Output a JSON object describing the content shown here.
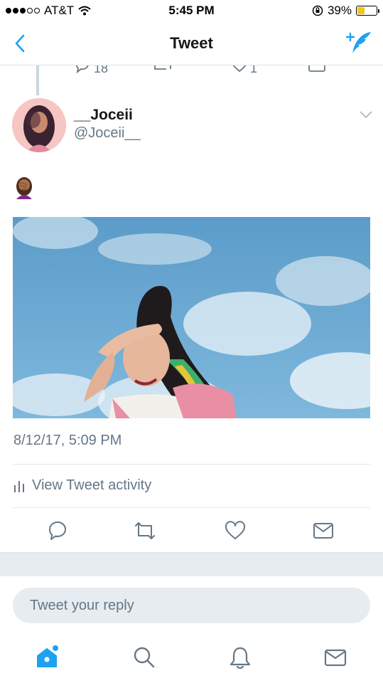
{
  "status_bar": {
    "carrier": "AT&T",
    "time": "5:45 PM",
    "battery_percent": "39%",
    "battery_level": 0.39,
    "signal_bars_filled": 3,
    "signal_bars_total": 5
  },
  "nav": {
    "title": "Tweet"
  },
  "previous_tweet": {
    "reply_count": "18",
    "like_count": "1"
  },
  "tweet": {
    "author_name": "__Joceii",
    "author_handle": "@Joceii__",
    "text_emoji": "🤦🏾‍♀️",
    "timestamp": "8/12/17, 5:09 PM",
    "activity_label": "View Tweet activity"
  },
  "reply": {
    "placeholder": "Tweet your reply"
  },
  "colors": {
    "accent": "#1da1f2",
    "muted": "#657786",
    "divider": "#e1e8ed"
  },
  "icons": {
    "back": "chevron-left-icon",
    "compose": "compose-quill-icon",
    "reply": "reply-bubble-icon",
    "retweet": "retweet-icon",
    "like": "heart-icon",
    "dm": "envelope-icon",
    "home": "home-icon",
    "search": "search-icon",
    "notifications": "bell-icon",
    "messages": "envelope-icon"
  }
}
